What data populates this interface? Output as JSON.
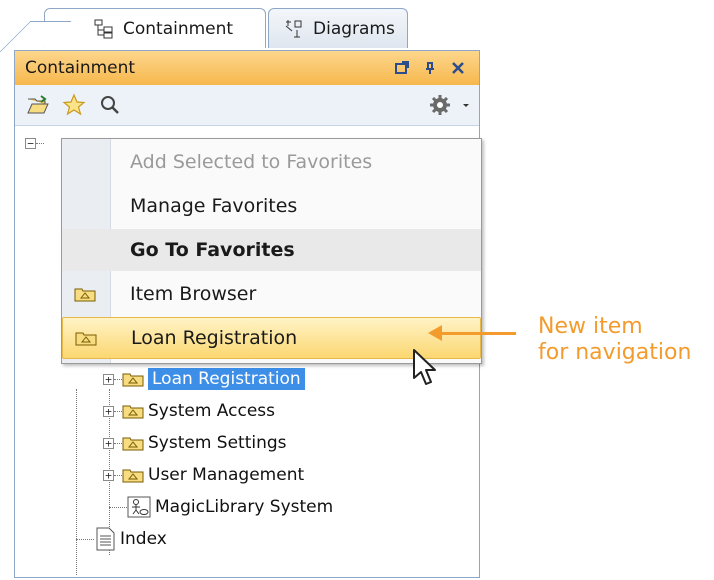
{
  "tabs": [
    {
      "label": "Containment",
      "icon": "containment-tree-icon",
      "active": true
    },
    {
      "label": "Diagrams",
      "icon": "diagrams-icon",
      "active": false
    }
  ],
  "panel": {
    "title": "Containment",
    "title_buttons": [
      "float-icon",
      "pin-icon",
      "close-icon"
    ]
  },
  "toolbar": {
    "icons": [
      "open-folder-icon",
      "favorites-star-icon",
      "search-icon"
    ],
    "right_icons": [
      "gear-icon",
      "dropdown-arrow-icon"
    ]
  },
  "menu": {
    "items": [
      {
        "label": "Add Selected to Favorites",
        "state": "disabled"
      },
      {
        "label": "Manage Favorites",
        "state": "normal"
      },
      {
        "label": "Go To Favorites",
        "state": "bold"
      },
      {
        "label": "Item Browser",
        "state": "normal",
        "icon": "package-icon"
      },
      {
        "label": "Loan Registration",
        "state": "highlighted",
        "icon": "package-icon"
      }
    ]
  },
  "tree": {
    "root_expander": "−",
    "items": [
      {
        "label": "Loan Registration",
        "icon": "package-icon",
        "expander": "+",
        "selected": true
      },
      {
        "label": "System Access",
        "icon": "package-icon",
        "expander": "+"
      },
      {
        "label": "System Settings",
        "icon": "package-icon",
        "expander": "+"
      },
      {
        "label": "User Management",
        "icon": "package-icon",
        "expander": "+"
      },
      {
        "label": "MagicLibrary System",
        "icon": "use-case-system-icon"
      },
      {
        "label": "Index",
        "icon": "document-icon"
      }
    ]
  },
  "annotation": {
    "line1": "New item",
    "line2": "for navigation",
    "color": "#f39c2d"
  },
  "colors": {
    "panel_title": "#f6b84c",
    "selection": "#3d8ee6",
    "menu_highlight": "#fbd771",
    "border": "#8ea7c6"
  }
}
